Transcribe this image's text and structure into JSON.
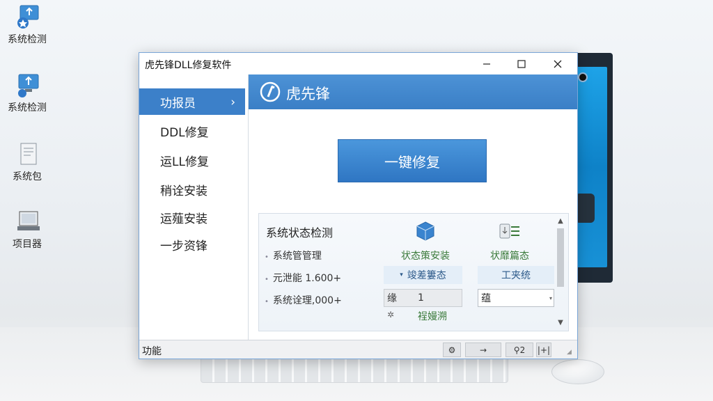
{
  "desktop": {
    "icons": [
      {
        "label": "系统检测",
        "icon": "monitor-shield-icon"
      },
      {
        "label": "系统检测",
        "icon": "monitor-upload-icon"
      },
      {
        "label": "系统包",
        "icon": "document-icon"
      },
      {
        "label": "项目器",
        "icon": "laptop-icon"
      }
    ]
  },
  "window": {
    "title": "虎先锋DLL修复软件",
    "controls": {
      "minimize": "—",
      "maximize": "☐",
      "close": "✕"
    }
  },
  "sidebar": {
    "items": [
      {
        "label": "功报员",
        "active": true,
        "chevron": "›"
      },
      {
        "label": "DDL修复"
      },
      {
        "label": "运LL修复"
      },
      {
        "label": "稍诠安装"
      },
      {
        "label": "运薤安装"
      },
      {
        "label": "一步资锋"
      }
    ]
  },
  "brand": {
    "name": "虎先锋",
    "color": "#3a7fc6"
  },
  "main": {
    "repair_button": "一键修复",
    "panel": {
      "title": "系统状态检测",
      "rows": [
        {
          "label": "系统管管理"
        },
        {
          "label": "元泄能 1.600+"
        },
        {
          "label": "系统诠理,000+"
        }
      ],
      "col1": {
        "head": "状态策安装",
        "icon": "package-icon",
        "cell": "竣差簍态",
        "field_prefix": "缘",
        "field_value": "1",
        "footer": "裎嫚溯"
      },
      "col2": {
        "head": "状靡篇态",
        "icon": "list-download-icon",
        "cell": "工夹统",
        "select_value": "蕴"
      }
    }
  },
  "statusbar": {
    "text": "功能",
    "buttons": [
      "⚙",
      "→",
      "⚲2",
      "|+|"
    ]
  }
}
